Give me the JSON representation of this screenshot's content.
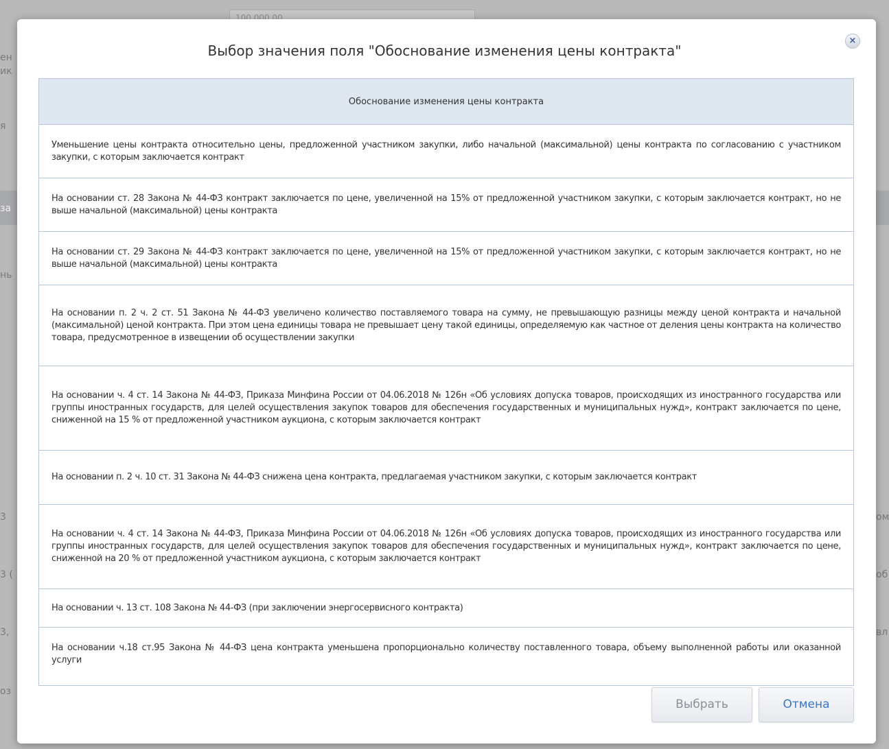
{
  "background": {
    "input_value": "100 000,00",
    "fragments": [
      "ен",
      "ик",
      "я",
      "за",
      "нь",
      "3",
      "ом",
      "3 (",
      "об",
      "3,",
      "вл",
      "оз"
    ]
  },
  "dialog": {
    "title": "Выбор значения поля \"Обоснование изменения цены контракта\"",
    "close_icon": "close-icon",
    "column_header": "Обоснование изменения цены контракта",
    "rows": [
      "Уменьшение цены контракта относительно цены, предложенной участником закупки, либо начальной (максимальной) цены контракта по согласованию с участником закупки, с которым заключается контракт",
      "На основании ст. 28 Закона № 44-ФЗ контракт заключается по цене, увеличенной на 15% от предложенной участником закупки, с которым заключается контракт, но не выше начальной (максимальной) цены контракта",
      "На основании ст. 29 Закона № 44-ФЗ контракт заключается по цене, увеличенной на 15% от предложенной участником закупки, с которым заключается контракт, но не выше начальной (максимальной) цены контракта",
      "На основании п. 2 ч. 2 ст. 51 Закона № 44-ФЗ увеличено количество поставляемого товара на сумму, не превышающую разницы между ценой контракта и начальной (максимальной) ценой контракта. При этом цена единицы товара не превышает цену такой единицы, определяемую как частное от деления цены контракта на количество товара, предусмотренное в извещении об осуществлении закупки",
      "На основании ч. 4 ст. 14 Закона № 44-ФЗ, Приказа Минфина России от 04.06.2018 № 126н «Об условиях допуска товаров, происходящих из иностранного государства или группы иностранных государств, для целей осуществления закупок товаров для обеспечения государственных и муниципальных нужд», контракт заключается по цене, сниженной на 15 % от предложенной участником аукциона, с которым заключается контракт",
      "На основании п. 2 ч. 10 ст. 31 Закона № 44-ФЗ снижена цена контракта, предлагаемая участником закупки, с которым заключается контракт",
      "На основании ч. 4 ст. 14 Закона № 44-ФЗ, Приказа Минфина России от 04.06.2018 № 126н «Об условиях допуска товаров, происходящих из иностранного государства или группы иностранных государств, для целей осуществления закупок товаров для обеспечения государственных и муниципальных нужд», контракт заключается по цене, сниженной на 20 % от предложенной участником аукциона, с которым заключается контракт",
      "На основании ч. 13 ст. 108 Закона № 44-ФЗ (при заключении энергосервисного контракта)",
      "На основании ч.18 ст.95 Закона № 44-ФЗ цена контракта уменьшена пропорционально количеству поставленного товара, объему выполненной работы или оказанной услуги"
    ],
    "buttons": {
      "select": "Выбрать",
      "cancel": "Отмена"
    },
    "colors": {
      "header_bg": "#dfe7f0",
      "border": "#b6c6d8",
      "cancel_text": "#3a76c4",
      "select_text": "#8a8f96"
    }
  }
}
